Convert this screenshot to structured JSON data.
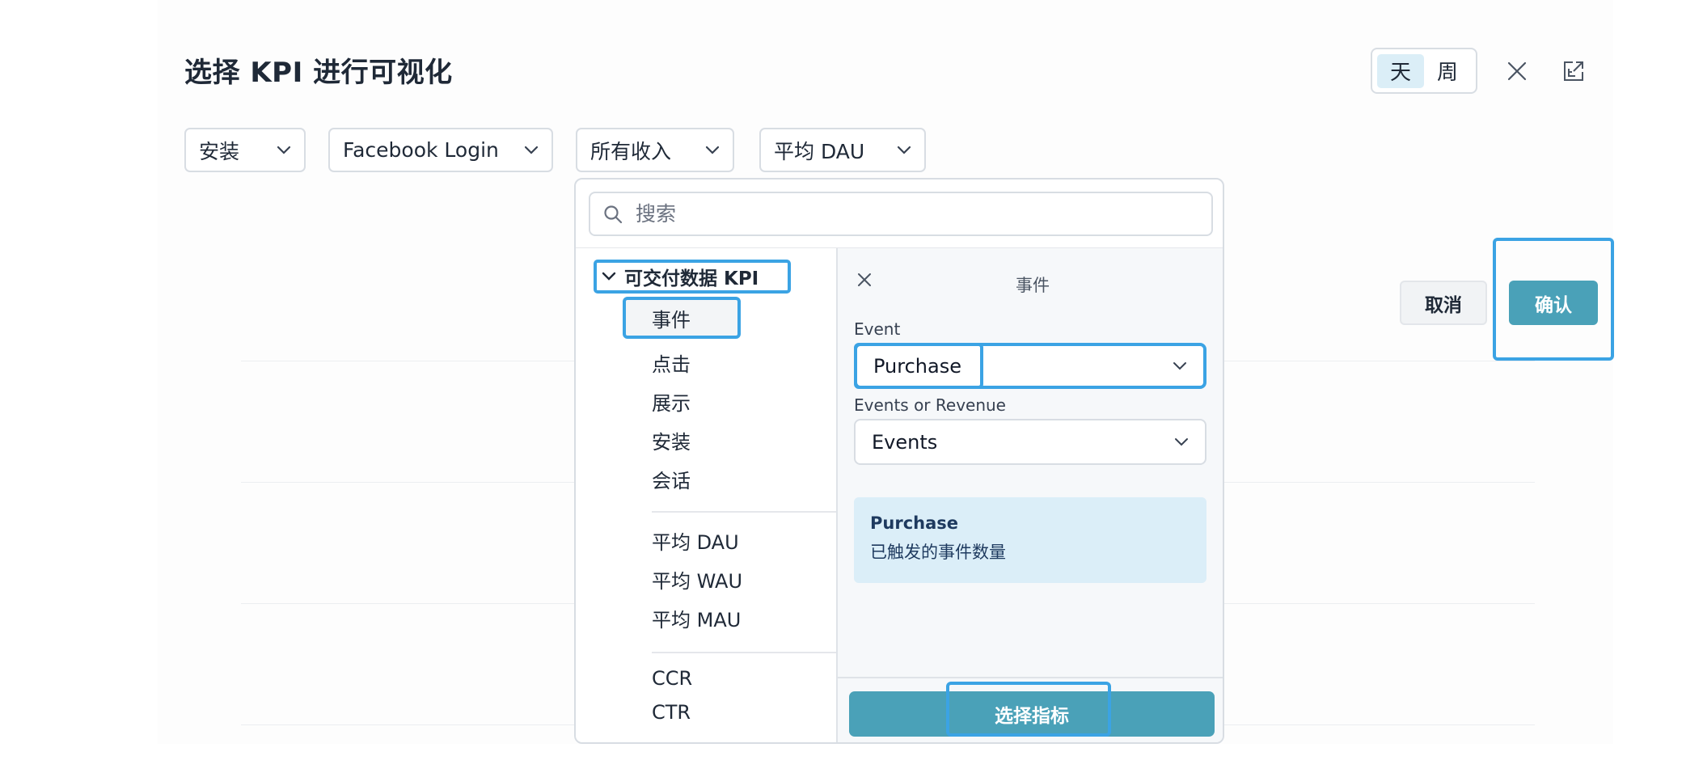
{
  "header": {
    "title": "选择 KPI 进行可视化",
    "period_toggle": {
      "day": "天",
      "week": "周",
      "selected": "天"
    },
    "close_icon": "close-icon",
    "export_icon": "export-icon"
  },
  "filters": [
    {
      "label": "安装"
    },
    {
      "label": "Facebook Login"
    },
    {
      "label": "所有收入"
    },
    {
      "label": "平均 DAU"
    }
  ],
  "popover": {
    "search_placeholder": "搜索",
    "group_label": "可交付数据 KPI",
    "items": {
      "event": "事件",
      "click": "点击",
      "impression": "展示",
      "install": "安装",
      "session": "会话",
      "avg_dau": "平均 DAU",
      "avg_wau": "平均 WAU",
      "avg_mau": "平均 MAU",
      "ccr": "CCR",
      "ctr": "CTR"
    },
    "selected_item": "事件",
    "panel": {
      "title": "事件",
      "event_label": "Event",
      "event_value": "Purchase",
      "mode_label": "Events or Revenue",
      "mode_value": "Events",
      "info_title": "Purchase",
      "info_desc": "已触发的事件数量",
      "select_button": "选择指标"
    }
  },
  "actions": {
    "cancel": "取消",
    "confirm": "确认"
  },
  "colors": {
    "accent": "#4aa1b8",
    "highlight": "#3ba3e4",
    "info_bg": "#dbeef8"
  }
}
